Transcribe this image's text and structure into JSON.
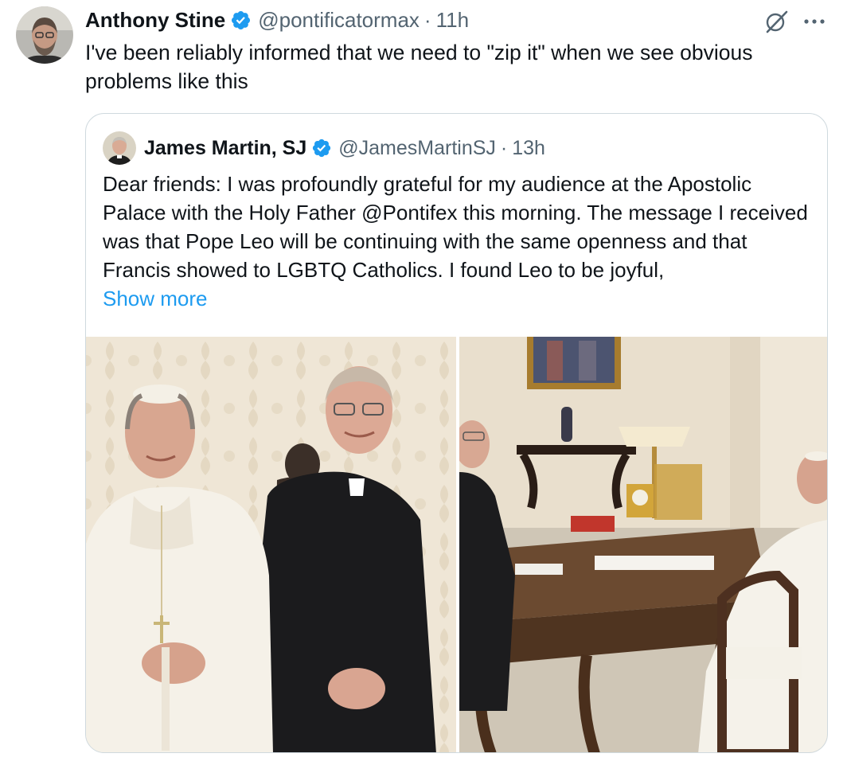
{
  "tweet": {
    "author": {
      "name": "Anthony Stine",
      "handle": "@pontificatormax",
      "verified_icon": "verified-badge-icon"
    },
    "separator": "·",
    "time": "11h",
    "text": "I've been reliably informed that we need to \"zip it\" when we see obvious problems like this",
    "icons": {
      "grok": "grok-slash-icon",
      "more": "more-dots-icon"
    }
  },
  "quote": {
    "author": {
      "name": "James Martin, SJ",
      "handle": "@JamesMartinSJ",
      "verified_icon": "verified-badge-icon"
    },
    "separator": "·",
    "time": "13h",
    "text": "Dear friends: I was profoundly grateful for my audience at the Apostolic Palace with the Holy Father @Pontifex  this morning. The message I received was that Pope Leo will be continuing with the same openness and that Francis showed to LGBTQ Catholics. I found Leo to be joyful,",
    "show_more": "Show more",
    "photos": [
      "photo-portrait-two-men",
      "photo-meeting-at-desk"
    ]
  },
  "colors": {
    "text_primary": "#0f1419",
    "text_secondary": "#536471",
    "link": "#1d9bf0",
    "verified": "#1d9bf0",
    "border": "#cfd9de"
  }
}
